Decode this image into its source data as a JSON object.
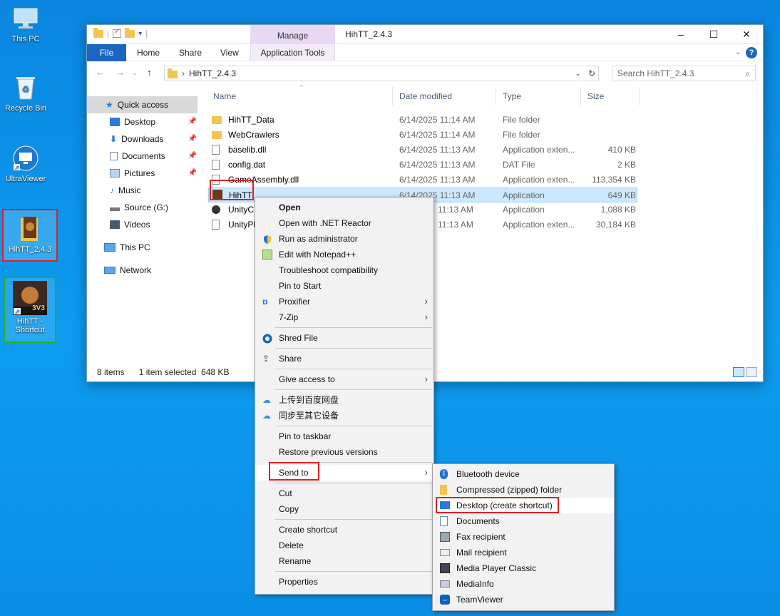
{
  "desktop": {
    "icons": [
      {
        "label": "This PC"
      },
      {
        "label": "Recycle Bin"
      },
      {
        "label": "UltraViewer"
      },
      {
        "label": "HihTT_2.4.3"
      },
      {
        "label": "HihTT - Shortcut",
        "badge": "3V3"
      }
    ]
  },
  "window": {
    "title": "HihTT_2.4.3",
    "manage_tab": "Manage",
    "ribbon_tabs": [
      "File",
      "Home",
      "Share",
      "View",
      "Application Tools"
    ],
    "address_path": "HihTT_2.4.3",
    "search_placeholder": "Search HihTT_2.4.3",
    "controls": {
      "minimize": "–",
      "maximize": "☐",
      "close": "✕"
    }
  },
  "nav": {
    "items": [
      {
        "label": "Quick access",
        "icon": "star-icon",
        "pinned": false
      },
      {
        "label": "Desktop",
        "icon": "desktop-icon",
        "pinned": true
      },
      {
        "label": "Downloads",
        "icon": "download-icon",
        "pinned": true
      },
      {
        "label": "Documents",
        "icon": "documents-icon",
        "pinned": true
      },
      {
        "label": "Pictures",
        "icon": "pictures-icon",
        "pinned": true
      },
      {
        "label": "Music",
        "icon": "music-icon",
        "pinned": false
      },
      {
        "label": "Source (G:)",
        "icon": "drive-icon",
        "pinned": false
      },
      {
        "label": "Videos",
        "icon": "videos-icon",
        "pinned": false
      },
      {
        "label": "This PC",
        "icon": "pc-icon",
        "pinned": false
      },
      {
        "label": "Network",
        "icon": "network-icon",
        "pinned": false
      }
    ]
  },
  "files": {
    "columns": [
      "Name",
      "Date modified",
      "Type",
      "Size"
    ],
    "rows": [
      {
        "name": "HihTT_Data",
        "date": "6/14/2025 11:14 AM",
        "type": "File folder",
        "size": "",
        "icon": "folder"
      },
      {
        "name": "WebCrawlers",
        "date": "6/14/2025 11:14 AM",
        "type": "File folder",
        "size": "",
        "icon": "folder"
      },
      {
        "name": "baselib.dll",
        "date": "6/14/2025 11:13 AM",
        "type": "Application exten...",
        "size": "410 KB",
        "icon": "dll"
      },
      {
        "name": "config.dat",
        "date": "6/14/2025 11:13 AM",
        "type": "DAT File",
        "size": "2 KB",
        "icon": "file"
      },
      {
        "name": "GameAssembly.dll",
        "date": "6/14/2025 11:13 AM",
        "type": "Application exten...",
        "size": "113,354 KB",
        "icon": "dll"
      },
      {
        "name": "HihTT",
        "date": "6/14/2025 11:13 AM",
        "type": "Application",
        "size": "649 KB",
        "icon": "app"
      },
      {
        "name": "UnityC",
        "date": "11:13 AM",
        "type": "Application",
        "size": "1,088 KB",
        "icon": "unity"
      },
      {
        "name": "UnityPl",
        "date": "11:13 AM",
        "type": "Application exten...",
        "size": "30,184 KB",
        "icon": "dll"
      }
    ]
  },
  "status": {
    "count": "8 items",
    "selection": "1 item selected",
    "size": "648 KB"
  },
  "context_menu": {
    "groups": [
      [
        "Open",
        "Open with .NET Reactor",
        "Run as administrator",
        "Edit with Notepad++",
        "Troubleshoot compatibility",
        "Pin to Start",
        "Proxifier",
        "7-Zip"
      ],
      [
        "Shred File"
      ],
      [
        "Share"
      ],
      [
        "Give access to"
      ],
      [
        "上传到百度网盘",
        "同步至其它设备"
      ],
      [
        "Pin to taskbar",
        "Restore previous versions"
      ],
      [
        "Send to"
      ],
      [
        "Cut",
        "Copy"
      ],
      [
        "Create shortcut",
        "Delete",
        "Rename"
      ],
      [
        "Properties"
      ]
    ]
  },
  "sendto_menu": {
    "items": [
      "Bluetooth device",
      "Compressed (zipped) folder",
      "Desktop (create shortcut)",
      "Documents",
      "Fax recipient",
      "Mail recipient",
      "Media Player Classic",
      "MediaInfo",
      "TeamViewer"
    ]
  },
  "colors": {
    "accent": "#1a66c2",
    "highlight_red": "#e02020",
    "highlight_green": "#22b022"
  }
}
